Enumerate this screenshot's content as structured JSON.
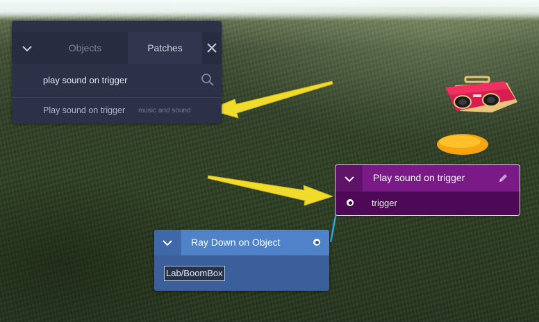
{
  "search_panel": {
    "tabs": [
      {
        "label": "Objects",
        "selected": false
      },
      {
        "label": "Patches",
        "selected": true
      }
    ],
    "search": {
      "value": "play sound on trigger",
      "placeholder": ""
    },
    "results": [
      {
        "title": "Play sound on trigger",
        "category": "music and sound"
      }
    ],
    "icons": {
      "collapse": "chevron-down-icon",
      "close": "close-icon",
      "search": "search-icon"
    }
  },
  "nodes": {
    "play_sound": {
      "title": "Play sound on trigger",
      "inputs": [
        {
          "label": "trigger"
        }
      ],
      "color": "#7a1a87",
      "body_color": "#4d0956"
    },
    "ray_down": {
      "title": "Ray Down on Object",
      "object_ref": "Lab/BoomBox",
      "color": "#4f82c9",
      "body_color": "#3a5f9a"
    }
  },
  "annotation_arrow_color": "#f1dc2c",
  "connection_color": "#2da6dd"
}
